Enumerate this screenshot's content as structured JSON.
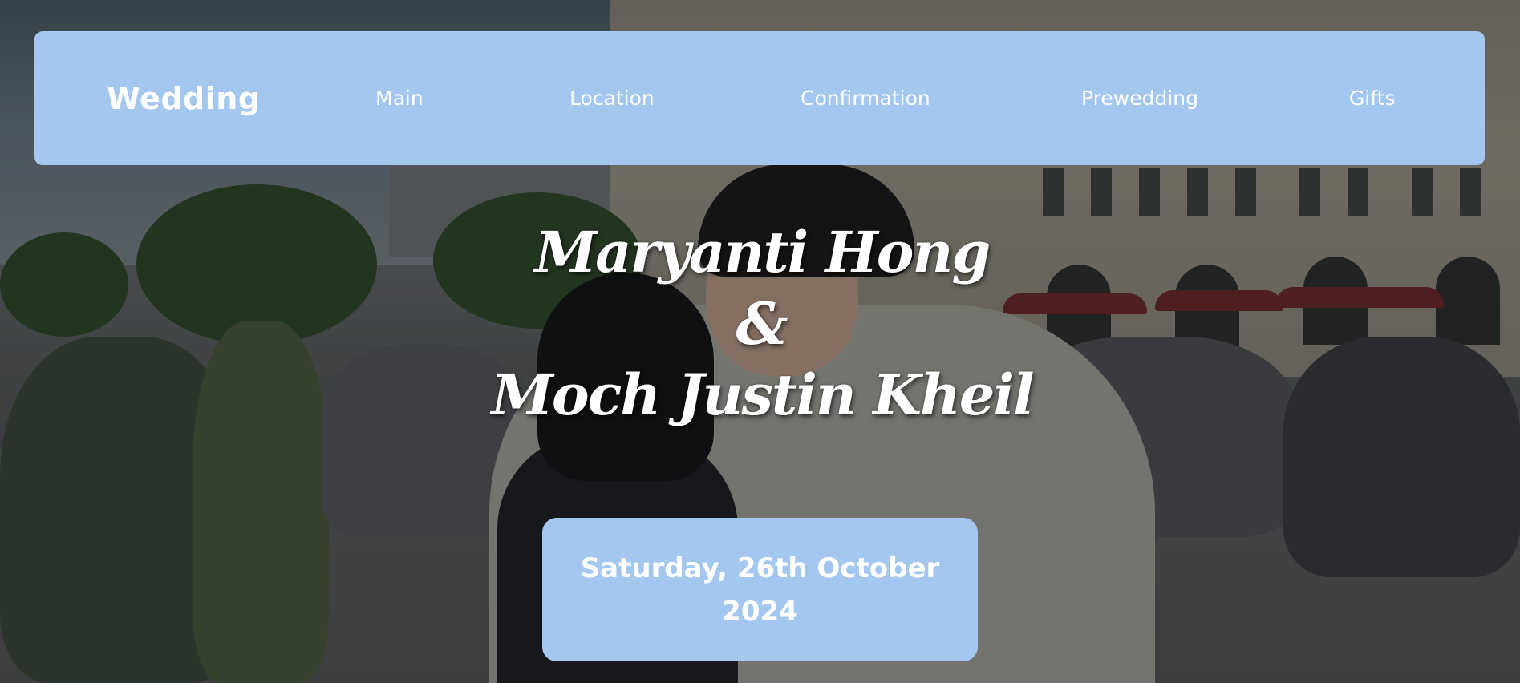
{
  "navbar": {
    "brand": "Wedding",
    "items": [
      {
        "label": "Main"
      },
      {
        "label": "Location"
      },
      {
        "label": "Confirmation"
      },
      {
        "label": "Prewedding"
      },
      {
        "label": "Gifts"
      }
    ]
  },
  "hero": {
    "bride": "Maryanti Hong",
    "ampersand": "&",
    "groom": "Moch Justin Kheil",
    "date": "Saturday, 26th October 2024"
  },
  "colors": {
    "accent": "#a3c7ee",
    "text": "#ffffff"
  }
}
